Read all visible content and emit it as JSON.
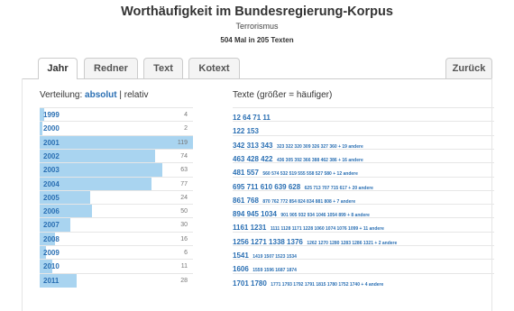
{
  "header": {
    "title": "Worthäufigkeit im Bundesregierung-Korpus",
    "subtitle": "Terrorismus",
    "count": "504 Mal in 205 Texten"
  },
  "tabs": {
    "jahr": "Jahr",
    "redner": "Redner",
    "text": "Text",
    "kotext": "Kotext",
    "zurueck": "Zurück"
  },
  "left": {
    "label": "Verteilung:",
    "absolut": "absolut",
    "sep": "|",
    "relativ": "relativ"
  },
  "right": {
    "label": "Texte (größer = häufiger)"
  },
  "years": [
    {
      "year": "1999",
      "count": "4",
      "fraction": 0.03,
      "big": "12 64 71 11",
      "small": ""
    },
    {
      "year": "2000",
      "count": "2",
      "fraction": 0.017,
      "big": "122 153",
      "small": ""
    },
    {
      "year": "2001",
      "count": "119",
      "fraction": 1.0,
      "big": "342 313 343",
      "small": "323 322 320 309 326 327 360 + 19 andere"
    },
    {
      "year": "2002",
      "count": "74",
      "fraction": 0.75,
      "big": "463 428 422",
      "small": "436 305 392 366 388 462 386 + 16 andere"
    },
    {
      "year": "2003",
      "count": "63",
      "fraction": 0.8,
      "big": "481 557",
      "small": "560 574 532 519 555 558 527 580 + 12 andere"
    },
    {
      "year": "2004",
      "count": "77",
      "fraction": 0.73,
      "big": "695 711 610 639 628",
      "small": "625 713 707 715 617 + 20 andere"
    },
    {
      "year": "2005",
      "count": "24",
      "fraction": 0.33,
      "big": "861 768",
      "small": "870 762 772 854 824 834 881 808 + 7 andere"
    },
    {
      "year": "2006",
      "count": "50",
      "fraction": 0.34,
      "big": "894 945 1034",
      "small": "901 905 932 934 1046 1054 899 + 8 andere"
    },
    {
      "year": "2007",
      "count": "30",
      "fraction": 0.2,
      "big": "1161 1231",
      "small": "1111 1128 1171 1228 1060 1074 1076 1099 + 11 andere"
    },
    {
      "year": "2008",
      "count": "16",
      "fraction": 0.1,
      "big": "1256 1271 1338 1376",
      "small": "1262 1270 1280 1283 1286 1321 + 2 andere"
    },
    {
      "year": "2009",
      "count": "6",
      "fraction": 0.04,
      "big": "1541",
      "small": "1419 1507 1523 1534"
    },
    {
      "year": "2010",
      "count": "11",
      "fraction": 0.08,
      "big": "1606",
      "small": "1559 1596 1687 1874"
    },
    {
      "year": "2011",
      "count": "28",
      "fraction": 0.24,
      "big": "1701 1780",
      "small": "1771 1793 1792 1791 1815 1780 1752 1740 + 4 andere"
    }
  ]
}
